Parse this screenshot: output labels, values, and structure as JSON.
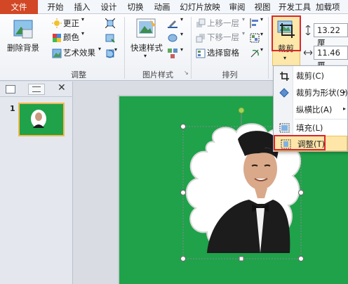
{
  "tabs": [
    {
      "label": "文件"
    },
    {
      "label": "开始"
    },
    {
      "label": "插入"
    },
    {
      "label": "设计"
    },
    {
      "label": "切换"
    },
    {
      "label": "动画"
    },
    {
      "label": "幻灯片放映"
    },
    {
      "label": "审阅"
    },
    {
      "label": "视图"
    },
    {
      "label": "开发工具"
    },
    {
      "label": "加载项"
    }
  ],
  "ribbon": {
    "remove_bg": "删除背景",
    "corrections": "更正",
    "color": "颜色",
    "artistic": "艺术效果",
    "adjust_group": "调整",
    "quick_styles": "快速样式",
    "picture_styles_group": "图片样式",
    "bring_forward": "上移一层",
    "send_backward": "下移一层",
    "selection_pane": "选择窗格",
    "arrange_group": "排列",
    "crop": "裁剪",
    "height": "13.22 厘",
    "width": "11.46 厘"
  },
  "crop_menu": {
    "items": [
      {
        "label": "裁剪(C)"
      },
      {
        "label": "裁剪为形状(S)"
      },
      {
        "label": "纵横比(A)"
      },
      {
        "label": "填充(L)"
      },
      {
        "label": "调整(T)"
      }
    ]
  },
  "left_pane": {
    "slide_number": "1"
  },
  "colors": {
    "file_tab": "#d24726",
    "slide_bg": "#1fa24a",
    "highlight_box": "#d9262c"
  }
}
